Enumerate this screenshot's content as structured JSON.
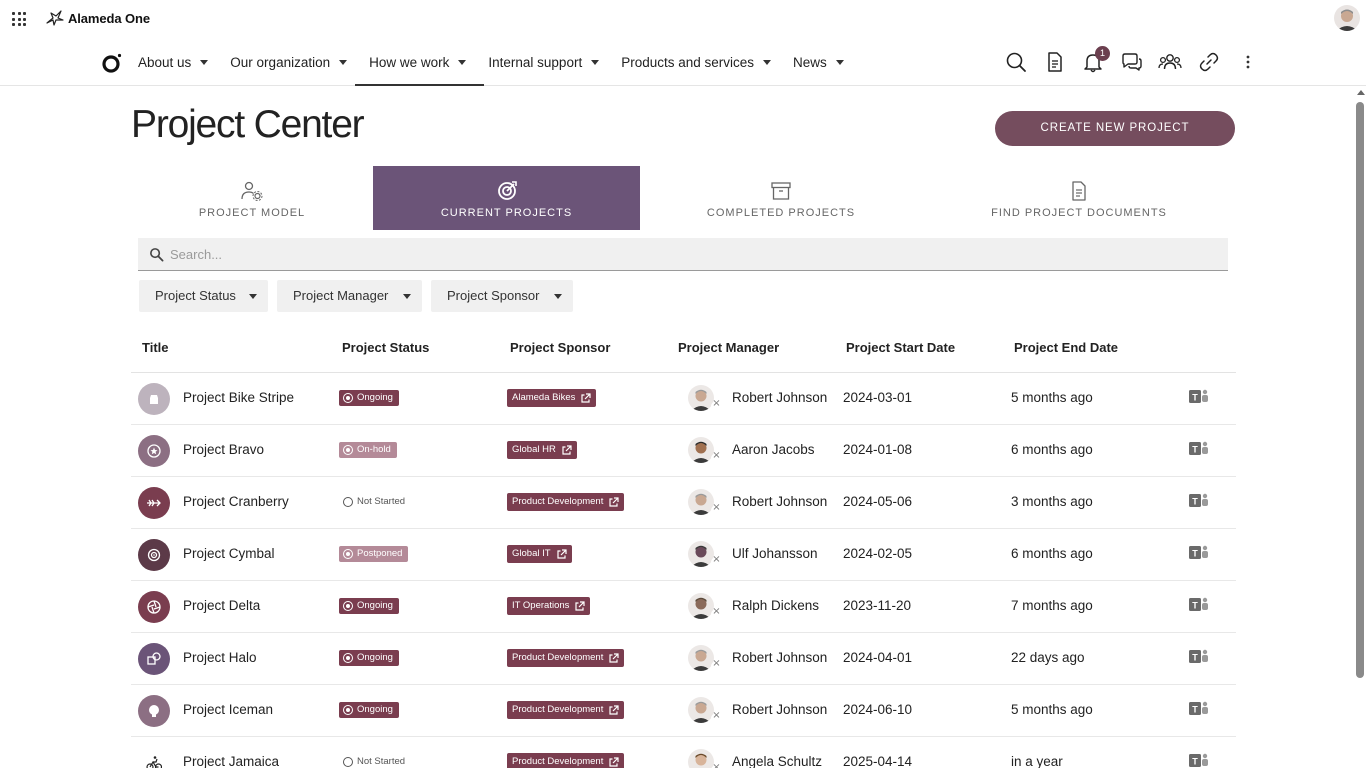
{
  "suite": {
    "brand_name": "Alameda One",
    "icons": [
      "app-launcher-icon",
      "brand-logo-icon",
      "user-avatar"
    ]
  },
  "nav": {
    "items": [
      {
        "label": "About us"
      },
      {
        "label": "Our organization"
      },
      {
        "label": "How we work",
        "active": true
      },
      {
        "label": "Internal support"
      },
      {
        "label": "Products and services"
      },
      {
        "label": "News"
      }
    ],
    "notification_count": "1",
    "icons": [
      "search-icon",
      "document-icon",
      "bell-icon",
      "chat-icon",
      "people-icon",
      "link-icon",
      "more-vertical-icon"
    ]
  },
  "page": {
    "title": "Project Center",
    "create_button": "CREATE NEW PROJECT"
  },
  "tabs": [
    {
      "label": "PROJECT MODEL",
      "icon": "user-settings-icon"
    },
    {
      "label": "CURRENT PROJECTS",
      "icon": "target-icon",
      "active": true
    },
    {
      "label": "COMPLETED PROJECTS",
      "icon": "archive-icon"
    },
    {
      "label": "FIND PROJECT DOCUMENTS",
      "icon": "document-icon"
    }
  ],
  "search": {
    "placeholder": "Search..."
  },
  "filters": [
    {
      "label": "Project Status"
    },
    {
      "label": "Project Manager"
    },
    {
      "label": "Project Sponsor"
    }
  ],
  "table": {
    "headers": {
      "title": "Title",
      "status": "Project Status",
      "sponsor": "Project Sponsor",
      "manager": "Project Manager",
      "start": "Project Start Date",
      "end": "Project End Date"
    },
    "rows": [
      {
        "title": "Project Bike Stripe",
        "status": "Ongoing",
        "status_style": "dark",
        "sponsor": "Alameda Bikes",
        "manager": "Robert Johnson",
        "start": "2024-03-01",
        "end": "5 months ago",
        "icon_color": "#bdb3bd",
        "icon": "bike-shop-icon"
      },
      {
        "title": "Project Bravo",
        "status": "On-hold",
        "status_style": "light",
        "sponsor": "Global HR",
        "manager": "Aaron Jacobs",
        "start": "2024-01-08",
        "end": "6 months ago",
        "icon_color": "#8c6f83",
        "icon": "star-badge-icon"
      },
      {
        "title": "Project Cranberry",
        "status": "Not Started",
        "status_style": "none",
        "sponsor": "Product Development",
        "manager": "Robert Johnson",
        "start": "2024-05-06",
        "end": "3 months ago",
        "icon_color": "#7a3d4f",
        "icon": "arrow-icon"
      },
      {
        "title": "Project Cymbal",
        "status": "Postponed",
        "status_style": "light",
        "sponsor": "Global IT",
        "manager": "Ulf Johansson",
        "start": "2024-02-05",
        "end": "6 months ago",
        "icon_color": "#5c3a48",
        "icon": "target-icon"
      },
      {
        "title": "Project Delta",
        "status": "Ongoing",
        "status_style": "dark",
        "sponsor": "IT Operations",
        "manager": "Ralph Dickens",
        "start": "2023-11-20",
        "end": "7 months ago",
        "icon_color": "#7a3d4f",
        "icon": "aperture-icon"
      },
      {
        "title": "Project Halo",
        "status": "Ongoing",
        "status_style": "dark",
        "sponsor": "Product Development",
        "manager": "Robert Johnson",
        "start": "2024-04-01",
        "end": "22 days ago",
        "icon_color": "#6b5478",
        "icon": "shapes-icon"
      },
      {
        "title": "Project Iceman",
        "status": "Ongoing",
        "status_style": "dark",
        "sponsor": "Product Development",
        "manager": "Robert Johnson",
        "start": "2024-06-10",
        "end": "5 months ago",
        "icon_color": "#8c6f83",
        "icon": "lightbulb-icon"
      },
      {
        "title": "Project Jamaica",
        "status": "Not Started",
        "status_style": "none",
        "sponsor": "Product Development",
        "manager": "Angela Schultz",
        "start": "2025-04-14",
        "end": "in a year",
        "icon_color": "#ffffff",
        "icon": "cyclist-icon"
      }
    ]
  },
  "colors": {
    "accent": "#754d5e",
    "active_tab": "#6b5478",
    "tag": "#7a3d4f",
    "tag_light": "#b48a98"
  }
}
